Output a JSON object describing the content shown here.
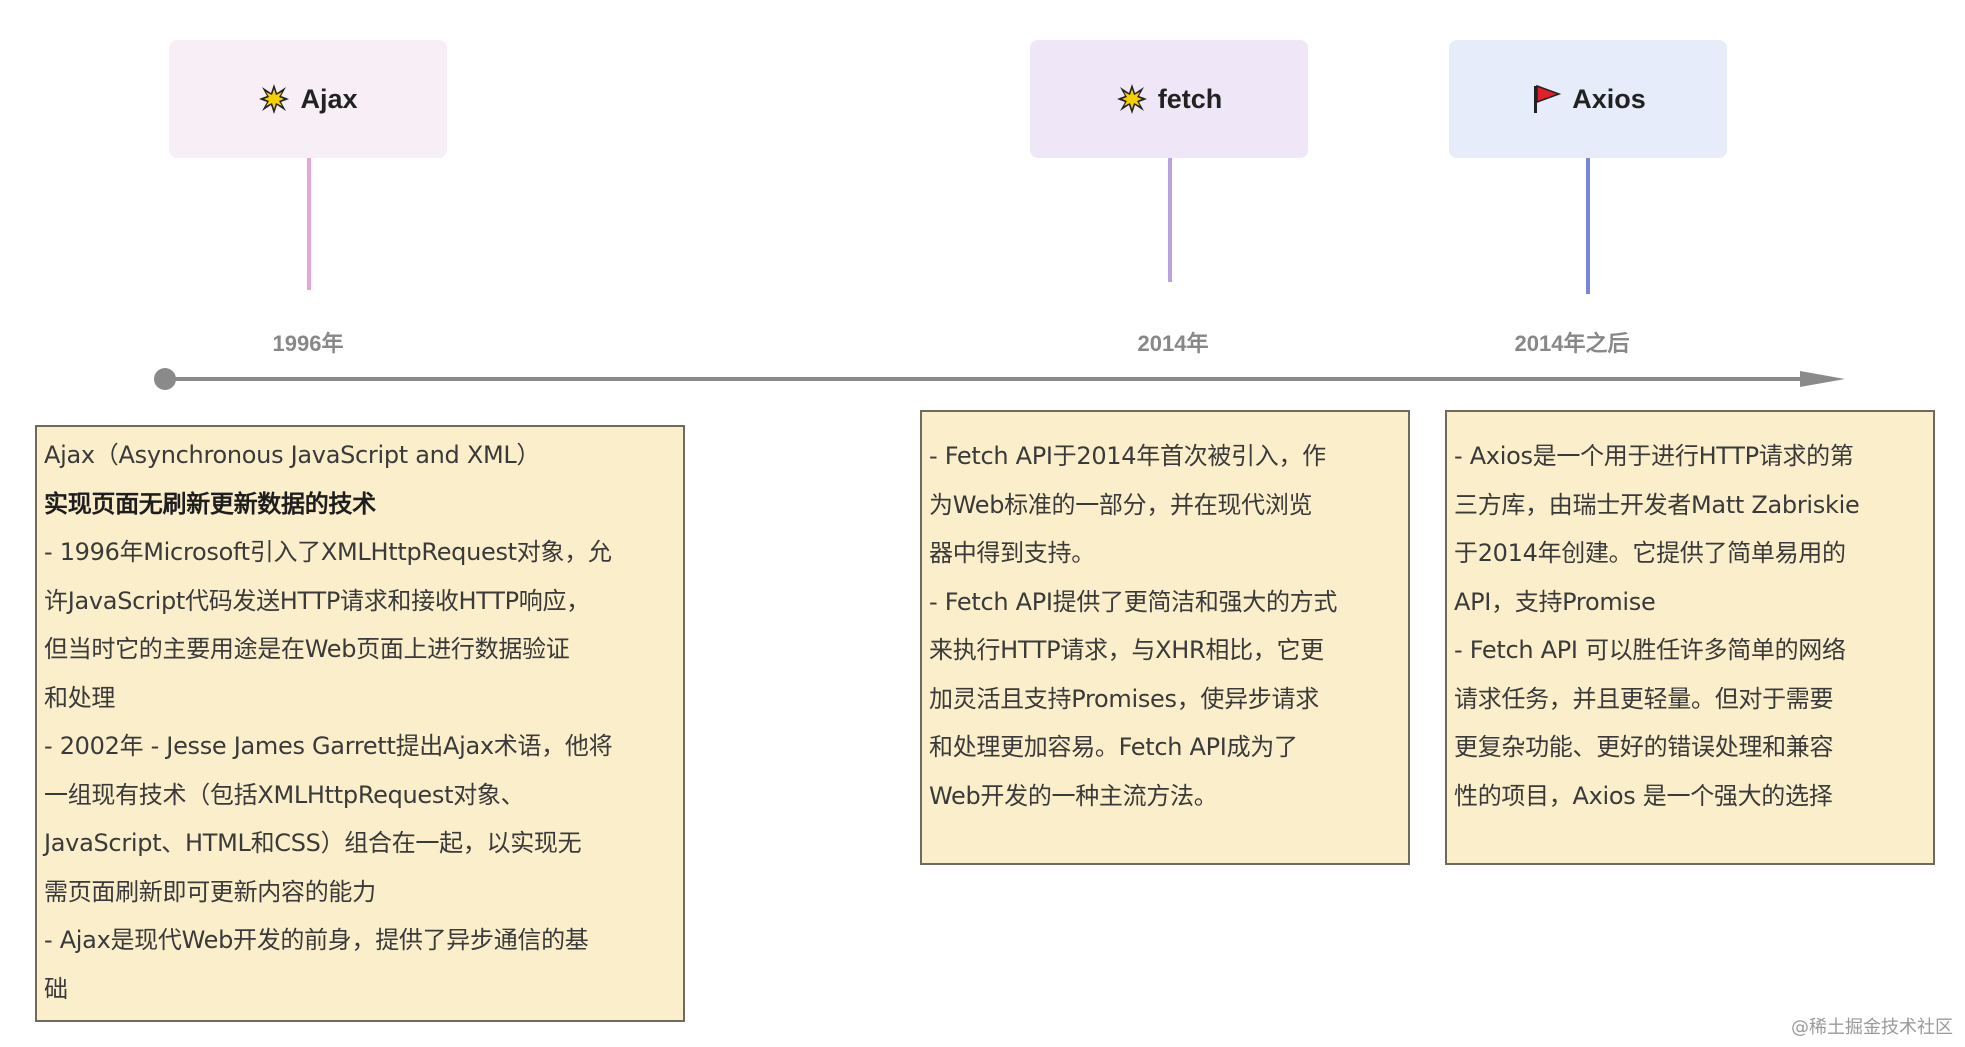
{
  "timeline": {
    "events": [
      {
        "label": "Ajax",
        "icon": "collision-icon",
        "year": "1996年",
        "color": "#f8eef6",
        "stem_color": "#e8a6d8"
      },
      {
        "label": "fetch",
        "icon": "collision-icon",
        "year": "2014年",
        "color": "#efe6f8",
        "stem_color": "#b8a4dc"
      },
      {
        "label": "Axios",
        "icon": "red-flag-icon",
        "year": "2014年之后",
        "color": "#e6ecfa",
        "stem_color": "#7a86d8"
      }
    ],
    "axis_color": "#888888"
  },
  "notes": {
    "ajax": {
      "title": "Ajax（Asynchronous JavaScript and XML）",
      "subtitle": "实现页面无刷新更新数据的技术",
      "lines": [
        "- 1996年Microsoft引入了XMLHttpRequest对象，允",
        "许JavaScript代码发送HTTP请求和接收HTTP响应，",
        "但当时它的主要用途是在Web页面上进行数据验证",
        "和处理",
        "- 2002年 - Jesse James Garrett提出Ajax术语，他将",
        "一组现有技术（包括XMLHttpRequest对象、",
        "JavaScript、HTML和CSS）组合在一起，以实现无",
        "需页面刷新即可更新内容的能力",
        "- Ajax是现代Web开发的前身，提供了异步通信的基",
        "础"
      ]
    },
    "fetch": {
      "lines": [
        "- Fetch API于2014年首次被引入，作",
        "为Web标准的一部分，并在现代浏览",
        "器中得到支持。",
        "- Fetch API提供了更简洁和强大的方式",
        "来执行HTTP请求，与XHR相比，它更",
        "加灵活且支持Promises，使异步请求",
        "和处理更加容易。Fetch API成为了",
        "Web开发的一种主流方法。"
      ]
    },
    "axios": {
      "lines": [
        "- Axios是一个用于进行HTTP请求的第",
        "三方库，由瑞士开发者Matt Zabriskie",
        "于2014年创建。它提供了简单易用的",
        "API，支持Promise",
        "- Fetch API 可以胜任许多简单的网络",
        "请求任务，并且更轻量。但对于需要",
        "更复杂功能、更好的错误处理和兼容",
        "性的项目，Axios 是一个强大的选择"
      ]
    }
  },
  "watermark": "@稀土掘金技术社区",
  "note_background": "#fbefcb"
}
